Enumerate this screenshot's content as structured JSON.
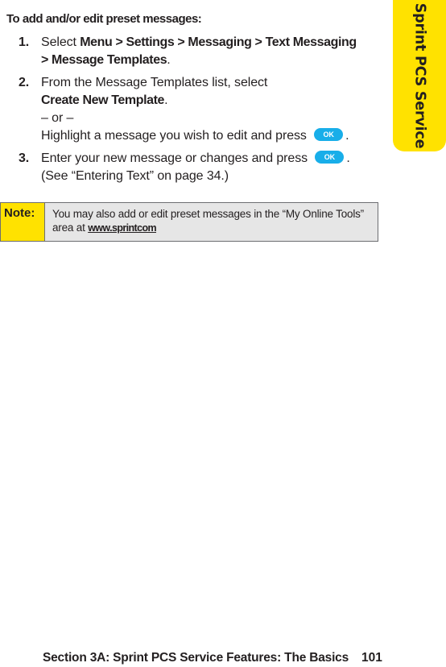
{
  "side_tab": {
    "label": "Sprint PCS Service",
    "color": "#ffe200"
  },
  "heading": "To add and/or edit preset messages:",
  "steps": [
    {
      "number": "1.",
      "text_prefix": "Select ",
      "path": [
        "Menu",
        "Settings",
        "Messaging",
        "Text Messaging",
        "Message Templates"
      ],
      "separator": " > "
    },
    {
      "number": "2.",
      "line1": "From the Message Templates list, select",
      "bold_option": "Create New Template",
      "or_text": "– or –",
      "line_alt": "Highlight a message you wish to edit and press",
      "button_label": "OK"
    },
    {
      "number": "3.",
      "line1": "Enter your new message or changes and press",
      "button_label": "OK",
      "line2": "(See “Entering Text” on page 34.)"
    }
  ],
  "note": {
    "label": "Note:",
    "text": "You may also add or edit preset messages in the “My Online Tools” area at ",
    "link": "www.sprintcom"
  },
  "footer": {
    "section": "Section 3A: Sprint PCS Service Features: The Basics",
    "page_number": "101"
  },
  "colors": {
    "accent_yellow": "#ffe200",
    "ok_button": "#18aee9",
    "note_bg": "#e6e6e6"
  }
}
